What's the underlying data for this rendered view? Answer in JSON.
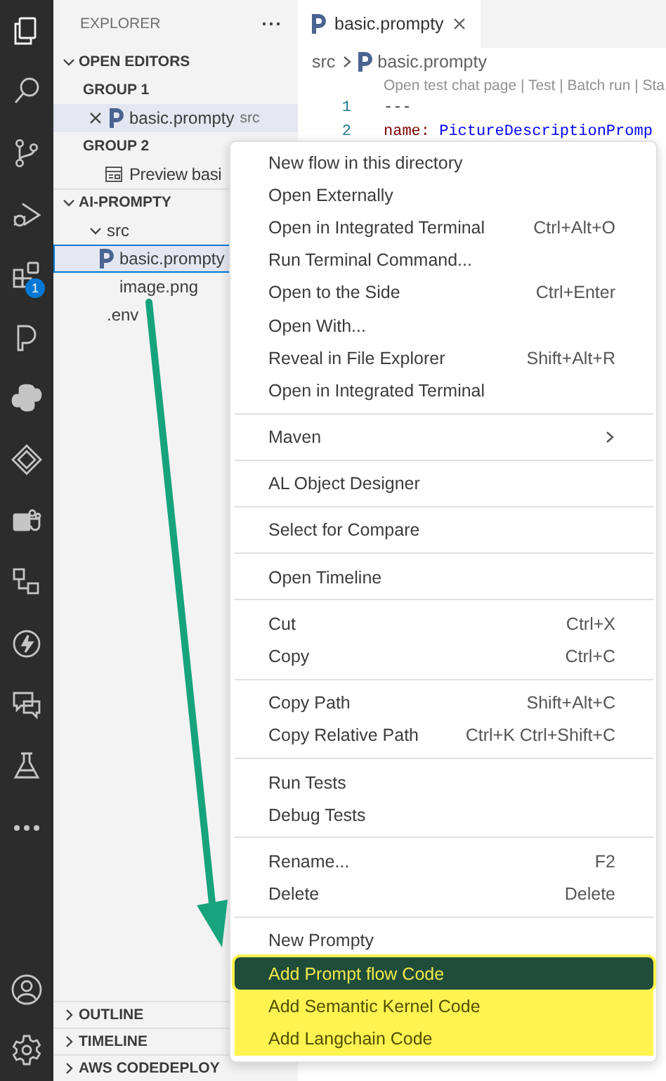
{
  "activity_bar": {
    "items": [
      {
        "kind": "explorer",
        "selected": true
      },
      {
        "kind": "search",
        "selected": false
      },
      {
        "kind": "source-control",
        "selected": false
      },
      {
        "kind": "run-debug",
        "selected": false
      },
      {
        "kind": "extensions",
        "selected": false,
        "badge": "1"
      },
      {
        "kind": "prompty",
        "selected": false
      },
      {
        "kind": "python",
        "selected": false
      },
      {
        "kind": "diamond",
        "selected": false
      },
      {
        "kind": "teams",
        "selected": false
      },
      {
        "kind": "nodes",
        "selected": false
      },
      {
        "kind": "lightning",
        "selected": false
      },
      {
        "kind": "chat",
        "selected": false
      },
      {
        "kind": "flask",
        "selected": false
      },
      {
        "kind": "more",
        "selected": false
      }
    ],
    "bottom_items": [
      {
        "kind": "account"
      },
      {
        "kind": "settings"
      }
    ]
  },
  "sidebar": {
    "title": "EXPLORER",
    "open_editors": {
      "label": "OPEN EDITORS",
      "expanded": true,
      "groups": [
        {
          "label": "GROUP 1",
          "files": [
            {
              "name": "basic.prompty",
              "detail": "src",
              "kind": "prompty",
              "selected": true
            }
          ]
        },
        {
          "label": "GROUP 2",
          "files": [
            {
              "name": "Preview basi",
              "kind": "preview",
              "selected": false
            }
          ]
        }
      ]
    },
    "folder": {
      "label": "AI-PROMPTY",
      "expanded": true,
      "children": [
        {
          "name": "src",
          "kind": "folder",
          "expanded": true,
          "selected": false,
          "children": [
            {
              "name": "basic.prompty",
              "kind": "prompty",
              "selected": true
            },
            {
              "name": "image.png",
              "kind": "file",
              "selected": false
            }
          ]
        },
        {
          "name": ".env",
          "kind": "file",
          "selected": false
        }
      ]
    },
    "sections": [
      {
        "label": "OUTLINE",
        "expanded": false
      },
      {
        "label": "TIMELINE",
        "expanded": false
      },
      {
        "label": "AWS CODEDEPLOY",
        "expanded": false
      }
    ]
  },
  "editor": {
    "tabs": [
      {
        "label": "basic.prompty",
        "selected": true
      }
    ],
    "breadcrumb": [
      "src",
      "basic.prompty"
    ],
    "codelens": "Open test chat page | Test | Batch run | Sta",
    "lines": [
      {
        "number": "1",
        "segments": [
          {
            "text": "---",
            "kind": "plain"
          }
        ]
      },
      {
        "number": "2",
        "segments": [
          {
            "text": "name:",
            "kind": "key"
          },
          {
            "text": "PictureDescriptionPromp",
            "kind": "value"
          }
        ]
      }
    ]
  },
  "context_menu": {
    "groups": [
      {
        "items": [
          {
            "label": "New flow in this directory",
            "selected": false,
            "highlighted": false
          },
          {
            "label": "Open Externally",
            "selected": false,
            "highlighted": false
          },
          {
            "label": "Open in Integrated Terminal",
            "shortcut": "Ctrl+Alt+O",
            "selected": false,
            "highlighted": false
          },
          {
            "label": "Run Terminal Command...",
            "selected": false,
            "highlighted": false
          },
          {
            "label": "Open to the Side",
            "shortcut": "Ctrl+Enter",
            "selected": false,
            "highlighted": false
          },
          {
            "label": "Open With...",
            "selected": false,
            "highlighted": false
          },
          {
            "label": "Reveal in File Explorer",
            "shortcut": "Shift+Alt+R",
            "selected": false,
            "highlighted": false
          },
          {
            "label": "Open in Integrated Terminal",
            "selected": false,
            "highlighted": false
          }
        ]
      },
      {
        "items": [
          {
            "label": "Maven",
            "submenu": true,
            "selected": false,
            "highlighted": false
          }
        ]
      },
      {
        "items": [
          {
            "label": "AL Object Designer",
            "selected": false,
            "highlighted": false
          }
        ]
      },
      {
        "items": [
          {
            "label": "Select for Compare",
            "selected": false,
            "highlighted": false
          }
        ]
      },
      {
        "items": [
          {
            "label": "Open Timeline",
            "selected": false,
            "highlighted": false
          }
        ]
      },
      {
        "items": [
          {
            "label": "Cut",
            "shortcut": "Ctrl+X",
            "selected": false,
            "highlighted": false
          },
          {
            "label": "Copy",
            "shortcut": "Ctrl+C",
            "selected": false,
            "highlighted": false
          }
        ]
      },
      {
        "items": [
          {
            "label": "Copy Path",
            "shortcut": "Shift+Alt+C",
            "selected": false,
            "highlighted": false
          },
          {
            "label": "Copy Relative Path",
            "shortcut": "Ctrl+K Ctrl+Shift+C",
            "selected": false,
            "highlighted": false
          }
        ]
      },
      {
        "items": [
          {
            "label": "Run Tests",
            "selected": false,
            "highlighted": false
          },
          {
            "label": "Debug Tests",
            "selected": false,
            "highlighted": false
          }
        ]
      },
      {
        "items": [
          {
            "label": "Rename...",
            "shortcut": "F2",
            "selected": false,
            "highlighted": false
          },
          {
            "label": "Delete",
            "shortcut": "Delete",
            "selected": false,
            "highlighted": false
          }
        ]
      },
      {
        "items": [
          {
            "label": "New Prompty",
            "selected": false,
            "highlighted": false
          },
          {
            "label": "Add Prompt flow Code",
            "selected": true,
            "highlighted": true
          },
          {
            "label": "Add Semantic Kernel Code",
            "selected": false,
            "highlighted": true
          },
          {
            "label": "Add Langchain Code",
            "selected": false,
            "highlighted": true
          }
        ]
      }
    ]
  }
}
